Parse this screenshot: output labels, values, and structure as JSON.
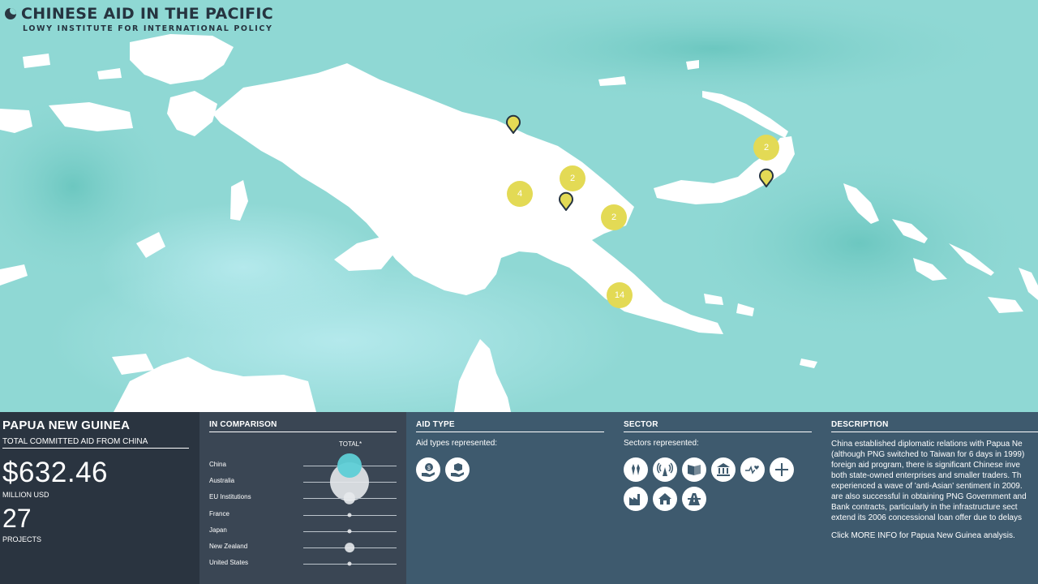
{
  "app": {
    "title": "CHINESE AID IN THE PACIFIC",
    "subtitle": "LOWY INSTITUTE FOR INTERNATIONAL POLICY"
  },
  "map": {
    "clusters": [
      {
        "label": "2",
        "name": "cluster-north"
      },
      {
        "label": "4",
        "name": "cluster-west"
      },
      {
        "label": "2",
        "name": "cluster-central"
      },
      {
        "label": "2",
        "name": "cluster-east"
      },
      {
        "label": "14",
        "name": "cluster-port-moresby"
      }
    ],
    "pins": [
      {
        "name": "pin-wewak"
      },
      {
        "name": "pin-highlands"
      },
      {
        "name": "pin-new-britain"
      }
    ],
    "colors": {
      "sea": "#8fd8d4",
      "land": "#ffffff",
      "cluster": "#e3da55",
      "pin": "#e3da55"
    }
  },
  "country": {
    "name": "PAPUA NEW GUINEA",
    "aid_label": "TOTAL COMMITTED AID FROM CHINA",
    "amount": "$632.46",
    "amount_unit": "MILLION USD",
    "projects": "27",
    "projects_label": "PROJECTS"
  },
  "comparison": {
    "title": "IN COMPARISON",
    "total_label": "TOTAL*",
    "rows": [
      {
        "label": "China",
        "share": 0.39
      },
      {
        "label": "Australia",
        "share": 1.0
      },
      {
        "label": "EU Institutions",
        "share": 0.09
      },
      {
        "label": "France",
        "share": 0.01
      },
      {
        "label": "Japan",
        "share": 0.01
      },
      {
        "label": "New Zealand",
        "share": 0.06
      },
      {
        "label": "United States",
        "share": 0.01
      }
    ]
  },
  "aid_type": {
    "title": "AID TYPE",
    "subtitle": "Aid types represented:",
    "icons": [
      "money-hand-icon",
      "box-hand-icon"
    ]
  },
  "sector": {
    "title": "SECTOR",
    "subtitle": "Sectors represented:",
    "icons": [
      "agriculture-icon",
      "communications-icon",
      "education-icon",
      "government-icon",
      "health-icon",
      "humanitarian-icon",
      "industry-icon",
      "housing-icon",
      "transport-icon"
    ]
  },
  "description": {
    "title": "DESCRIPTION",
    "lines": [
      "China established diplomatic relations with Papua Ne",
      "(although PNG switched to Taiwan for 6 days in 1999)",
      "foreign aid program, there is significant Chinese inve",
      "both state-owned enterprises and smaller traders. Th",
      "experienced a wave of 'anti-Asian' sentiment in 2009.",
      "are also successful in obtaining PNG Government and",
      "Bank contracts, particularly in the infrastructure sect",
      "extend its 2006 concessional loan offer due to delays"
    ],
    "more": "Click MORE INFO for Papua New Guinea analysis."
  }
}
